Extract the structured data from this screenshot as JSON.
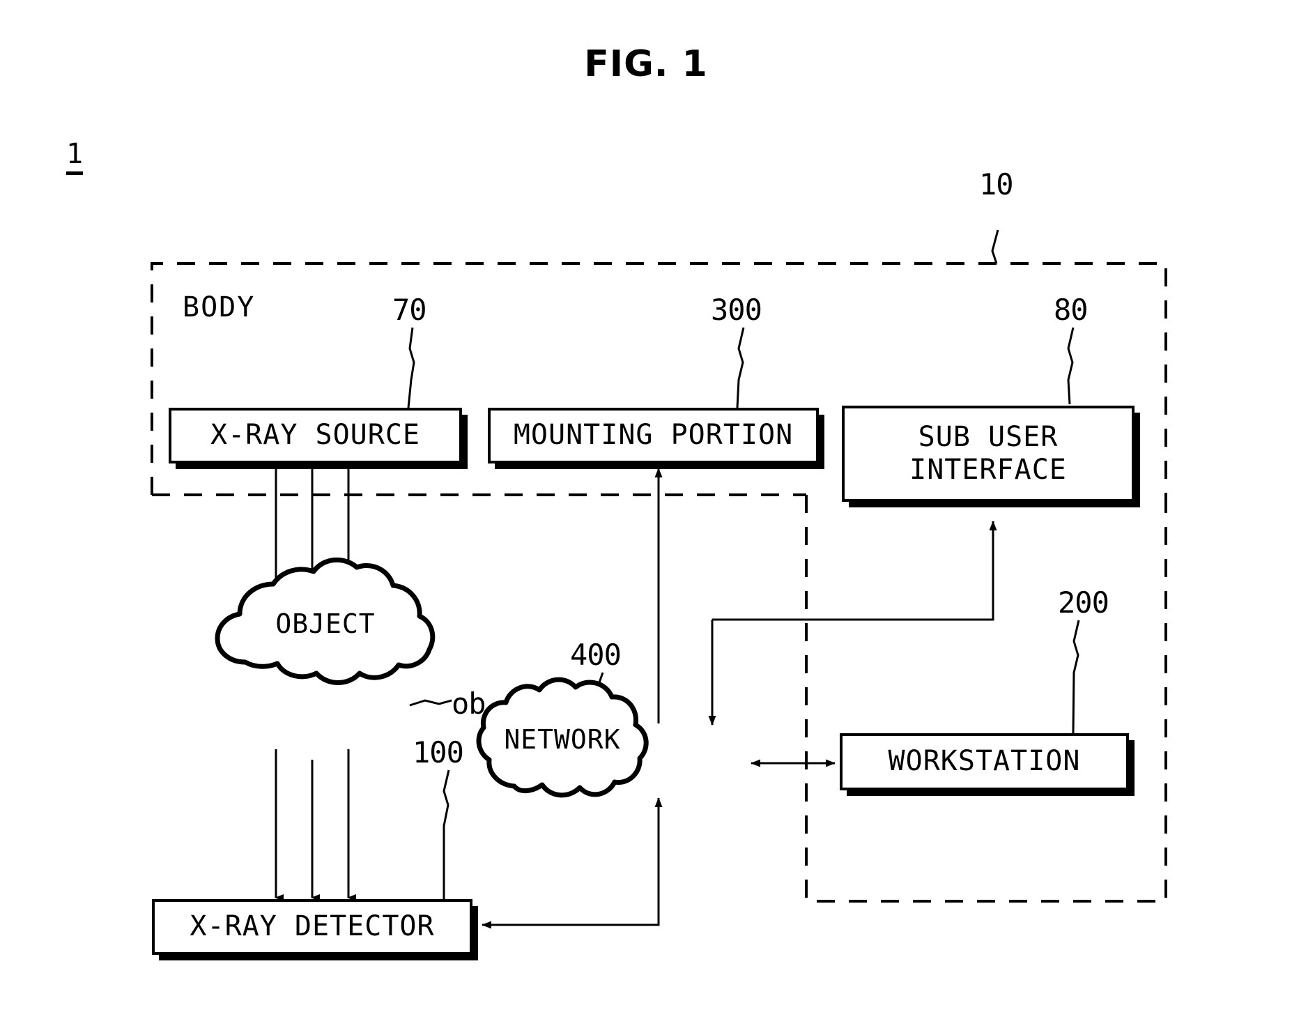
{
  "figure": {
    "title": "FIG. 1",
    "system_number": "1"
  },
  "enclosures": [
    {
      "name": "body-enclosure",
      "label": "BODY",
      "ref": "10"
    }
  ],
  "blocks": [
    {
      "name": "x-ray-source",
      "label": "X-RAY SOURCE",
      "ref": "70"
    },
    {
      "name": "mounting-portion",
      "label": "MOUNTING PORTION",
      "ref": "300"
    },
    {
      "name": "sub-user-interface",
      "label_line1": "SUB USER",
      "label_line2": "INTERFACE",
      "ref": "80"
    },
    {
      "name": "workstation",
      "label": "WORKSTATION",
      "ref": "200"
    },
    {
      "name": "x-ray-detector",
      "label": "X-RAY DETECTOR",
      "ref": "100"
    }
  ],
  "clouds": [
    {
      "name": "object-cloud",
      "label": "OBJECT",
      "ref": "ob"
    },
    {
      "name": "network-cloud",
      "label": "NETWORK",
      "ref": "400"
    }
  ],
  "labels": {
    "body": "BODY",
    "x_ray_source": "X-RAY SOURCE",
    "mounting_portion": "MOUNTING PORTION",
    "sub_user_interface_line1": "SUB USER",
    "sub_user_interface_line2": "INTERFACE",
    "workstation": "WORKSTATION",
    "x_ray_detector": "X-RAY DETECTOR",
    "object": "OBJECT",
    "network": "NETWORK"
  },
  "ref_numbers": {
    "system": "1",
    "body": "10",
    "x_ray_source": "70",
    "mounting_portion": "300",
    "sub_user_interface": "80",
    "object": "ob",
    "network": "400",
    "workstation": "200",
    "x_ray_detector": "100"
  },
  "colors": {
    "stroke": "#000000",
    "background": "#ffffff"
  }
}
